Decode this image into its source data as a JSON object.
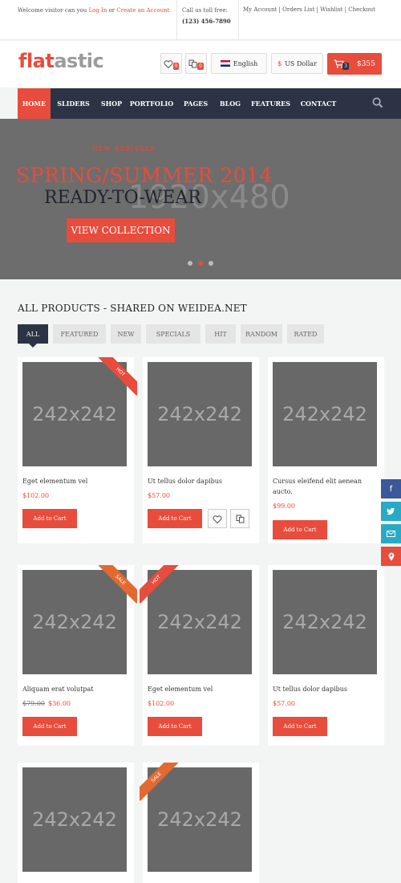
{
  "topbar": {
    "welcome_pre": "Welcome visitor can you",
    "login": "Log In",
    "or": "or",
    "create": "Create an Account",
    "call_label": "Call us toll free:",
    "phone": "(123) 456-7890",
    "links": [
      "My Account",
      "Orders List",
      "Wishlist",
      "Checkout"
    ],
    "sep": "|"
  },
  "header": {
    "logo_a": "flat",
    "logo_b": "astic",
    "wishlist_count": "0",
    "compare_count": "0",
    "language": "English",
    "currency_symbol": "$",
    "currency": "US Dollar",
    "cart_count": "3",
    "cart_total": "$355"
  },
  "nav": {
    "items": [
      "HOME",
      "SLIDERS",
      "SHOP",
      "PORTFOLIO",
      "PAGES",
      "BLOG",
      "FEATURES",
      "CONTACT"
    ]
  },
  "slider": {
    "placeholder": "1920x480",
    "kicker": "NEW ARRIVALS",
    "headline": "SPRING/SUMMER 2014",
    "subline": "READY-TO-WEAR",
    "cta": "VIEW COLLECTION"
  },
  "products_section": {
    "title": "ALL PRODUCTS - SHARED ON WEIDEA.NET",
    "tabs": [
      "ALL",
      "FEATURED",
      "NEW",
      "SPECIALS",
      "HIT",
      "RANDOM",
      "RATED"
    ]
  },
  "products": [
    {
      "img": "242x242",
      "name": "Eget elementum vel",
      "price": "$102.00",
      "btn": "Add to Cart",
      "ribbon": "HOT"
    },
    {
      "img": "242x242",
      "name": "Ut tellus dolor dapibus",
      "price": "$57.00",
      "btn": "Add to Cart"
    },
    {
      "img": "242x242",
      "name": "Cursus eleifend elit aenean aucto.",
      "price": "$99.00",
      "btn": "Add to Cart"
    },
    {
      "img": "242x242",
      "name": "Aliquam erat volutpat",
      "old_price": "$79.00",
      "price": "$36.00",
      "btn": "Add to Cart",
      "ribbon": "SALE"
    },
    {
      "img": "242x242",
      "name": "Eget elementum vel",
      "price": "$102.00",
      "btn": "Add to Cart",
      "ribbon": "HOT"
    },
    {
      "img": "242x242",
      "name": "Ut tellus dolor dapibus",
      "price": "$57.00",
      "btn": "Add to Cart"
    },
    {
      "img": "242x242"
    },
    {
      "img": "242x242",
      "ribbon": "SALE"
    }
  ],
  "social": {
    "items": [
      "facebook-icon",
      "twitter-icon",
      "mail-icon",
      "location-pin-icon"
    ],
    "colors": [
      "#3b5998",
      "#2aa9c4",
      "#2aa9c4",
      "#e74c3c"
    ]
  },
  "colors": {
    "accent": "#e74c3c",
    "dark": "#2b3344"
  }
}
